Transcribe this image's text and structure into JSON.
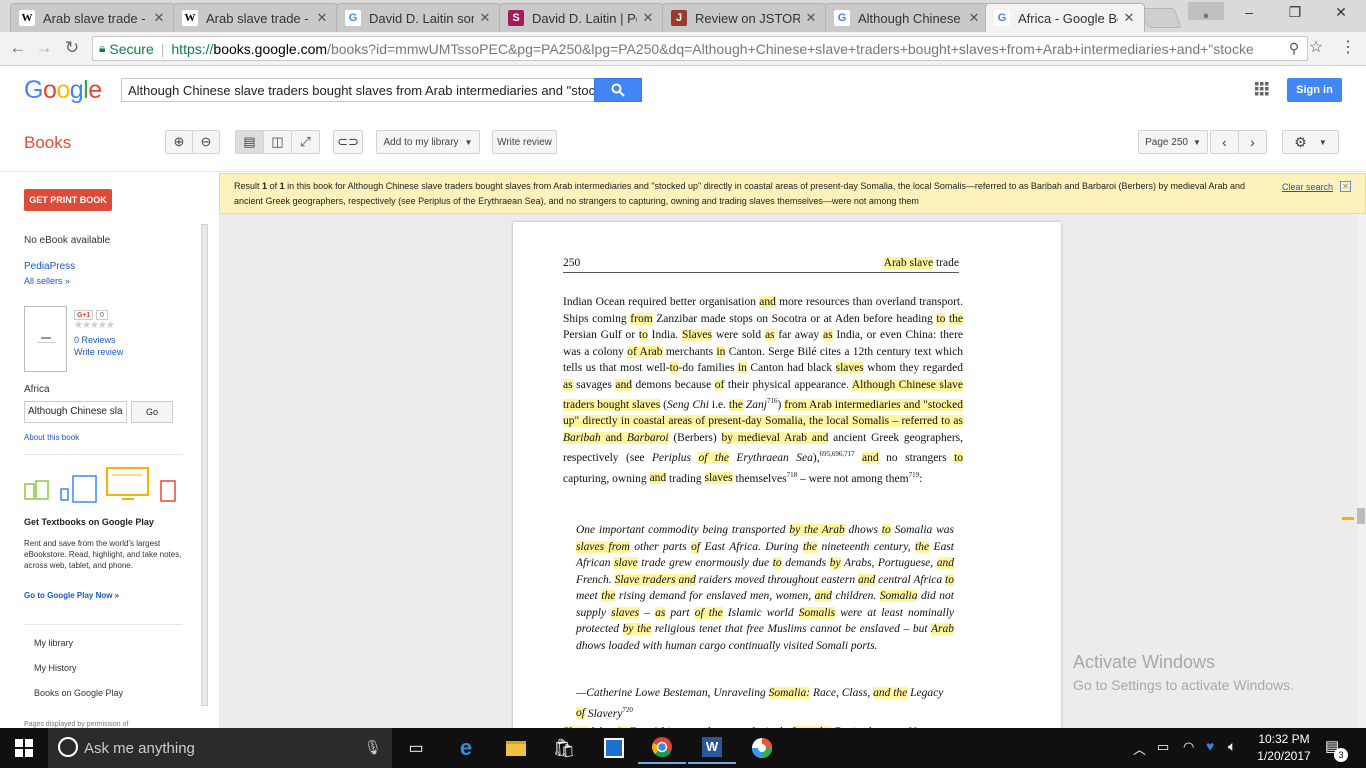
{
  "browser": {
    "tabs": [
      {
        "icon": "W",
        "title": "Arab slave trade - W",
        "active": false
      },
      {
        "icon": "W",
        "title": "Arab slave trade - W",
        "active": false
      },
      {
        "icon": "G",
        "title": "David D. Laitin som",
        "active": false
      },
      {
        "icon": "S",
        "title": "David D. Laitin | Po",
        "active": false
      },
      {
        "icon": "J",
        "title": "Review on JSTOR",
        "active": false
      },
      {
        "icon": "G",
        "title": "Although Chinese s",
        "active": false
      },
      {
        "icon": "G",
        "title": "Africa - Google Bo",
        "active": true
      }
    ],
    "secure_label": "Secure",
    "url_scheme": "https://",
    "url_host": "books.google.com",
    "url_rest": "/books?id=mmwUMTssoPEC&pg=PA250&lpg=PA250&dq=Although+Chinese+slave+traders+bought+slaves+from+Arab+intermediaries+and+\"stocke"
  },
  "google": {
    "logo": "Google",
    "search_value": "Although Chinese slave traders bought slaves from Arab intermediaries and \"stoc",
    "sign_in": "Sign in"
  },
  "books_bar": {
    "books_label": "Books",
    "add_library": "Add to my library",
    "write_review": "Write review",
    "page_select": "Page 250"
  },
  "sidebar": {
    "get_print": "GET PRINT BOOK",
    "no_ebook": "No eBook available",
    "pediapress": "PediaPress",
    "all_sellers": "All sellers »",
    "gplus": "G+1",
    "gplus_count": "0",
    "stars": "★★★★★",
    "reviews": "0 Reviews",
    "write_review": "Write review",
    "book_title": "Africa",
    "search_value": "Although Chinese sla",
    "go": "Go",
    "about": "About this book",
    "promo_title": "Get Textbooks on Google Play",
    "promo_text": "Rent and save from the world's largest eBookstore. Read, highlight, and take notes, across web, tablet, and phone.",
    "promo_link": "Go to Google Play Now »",
    "menu": [
      "My library",
      "My History",
      "Books on Google Play"
    ],
    "footer": "Pages displayed by permission of"
  },
  "result": {
    "prefix": "Result",
    "num": "1",
    "of": "of",
    "total": "1",
    "in_book": "in this book for",
    "query": "Although Chinese slave traders bought slaves from Arab intermediaries and \"stocked up\" directly in coastal areas of present-day Somalia, the local Somalis—referred to as Baribah and Barbaroi (Berbers) by medieval Arab and ancient Greek geographers, respectively (see Periplus of the Erythraean Sea), and no strangers to capturing, owning and trading slaves themselves—were not among them",
    "clear": "Clear search"
  },
  "page": {
    "number": "250",
    "header_hl": "Arab slave",
    "header_rest": "trade"
  },
  "watermark": {
    "title": "Activate Windows",
    "subtitle": "Go to Settings to activate Windows."
  },
  "taskbar": {
    "search_placeholder": "Ask me anything",
    "time": "10:32 PM",
    "date": "1/20/2017",
    "notifications": "3"
  }
}
